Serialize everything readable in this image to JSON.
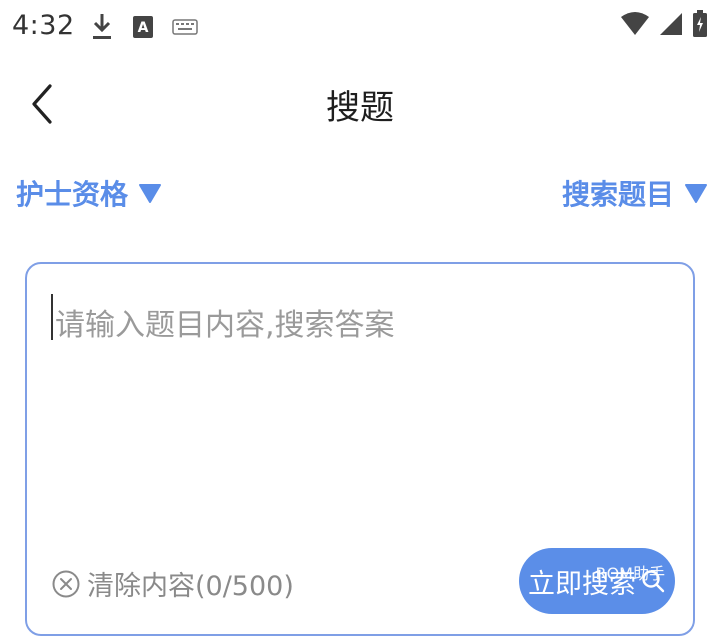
{
  "status_bar": {
    "time": "4:32",
    "left_icons": [
      "download-icon",
      "text-a-icon",
      "keyboard-icon"
    ],
    "right_icons": [
      "wifi-icon",
      "signal-icon",
      "battery-charging-icon"
    ]
  },
  "header": {
    "title": "搜题",
    "back_icon": "chevron-left-icon"
  },
  "filters": {
    "left_label": "护士资格",
    "right_label": "搜索题目"
  },
  "search": {
    "placeholder": "请输入题目内容,搜索答案",
    "clear_label": "清除内容(0/500)",
    "submit_label": "立即搜索",
    "watermark": "ROM助手"
  },
  "colors": {
    "accent": "#5b8ee8",
    "border": "#7f9fe6",
    "placeholder": "#9a9a9a"
  }
}
